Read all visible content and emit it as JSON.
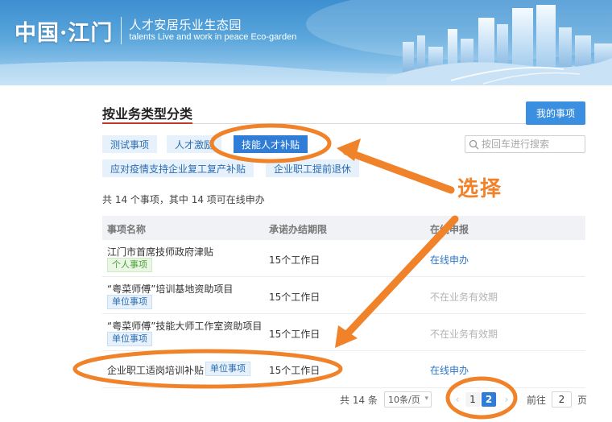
{
  "banner": {
    "logo": "中国·江门",
    "title_cn": "人才安居乐业生态园",
    "title_en": "talents Live and work in peace Eco-garden"
  },
  "section": {
    "title": "按业务类型分类",
    "my_items_button": "我的事项"
  },
  "tags": [
    {
      "label": "测试事项",
      "active": false
    },
    {
      "label": "人才激励",
      "active": false
    },
    {
      "label": "技能人才补贴",
      "active": true
    },
    {
      "label": "应对疫情支持企业复工复产补贴",
      "active": false
    },
    {
      "label": "企业职工提前退休",
      "active": false
    }
  ],
  "search": {
    "placeholder": "按回车进行搜索"
  },
  "summary": "共 14 个事项，其中 14 项可在线申办",
  "table": {
    "headers": [
      "事项名称",
      "承诺办结期限",
      "在线申报"
    ],
    "rows": [
      {
        "name": "江门市首席技师政府津贴",
        "badge": "个人事项",
        "deadline": "15个工作日",
        "apply": "在线申办",
        "online": true
      },
      {
        "name": "“粤菜师傅”培训基地资助项目",
        "badge": "单位事项",
        "deadline": "15个工作日",
        "apply": "不在业务有效期",
        "online": false
      },
      {
        "name": "“粤菜师傅”技能大师工作室资助项目",
        "badge": "单位事项",
        "deadline": "15个工作日",
        "apply": "不在业务有效期",
        "online": false
      },
      {
        "name": "企业职工适岗培训补贴",
        "badge": "单位事项",
        "deadline": "15个工作日",
        "apply": "在线申办",
        "online": true
      }
    ]
  },
  "pagination": {
    "total": "共 14 条",
    "page_size": "10条/页",
    "pages": [
      "1",
      "2"
    ],
    "current_page": "2",
    "goto_label": "前往",
    "goto_value": "2",
    "goto_unit": "页"
  },
  "annotation": {
    "label": "选择",
    "color": "#f0822a"
  },
  "colors": {
    "primary": "#2f7dd6",
    "accent_line": "#c0392b",
    "annotation": "#f0822a"
  }
}
